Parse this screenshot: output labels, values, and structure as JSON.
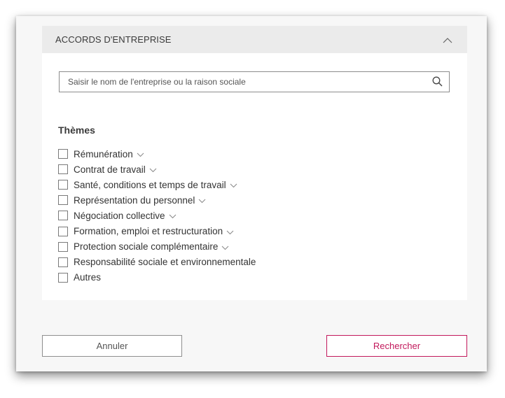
{
  "panel": {
    "title": "ACCORDS D'ENTREPRISE",
    "collapse_icon": "chevron-up-icon"
  },
  "search": {
    "placeholder": "Saisir le nom de l'entreprise ou la raison sociale",
    "value": "",
    "icon": "search-icon"
  },
  "themes": {
    "title": "Thèmes",
    "items": [
      {
        "label": "Rémunération",
        "expandable": true
      },
      {
        "label": "Contrat de travail",
        "expandable": true
      },
      {
        "label": "Santé, conditions et temps de travail",
        "expandable": true
      },
      {
        "label": "Représentation du personnel",
        "expandable": true
      },
      {
        "label": "Négociation collective",
        "expandable": true
      },
      {
        "label": "Formation, emploi et restructuration",
        "expandable": true
      },
      {
        "label": "Protection sociale complémentaire",
        "expandable": true
      },
      {
        "label": "Responsabilité sociale et environnementale",
        "expandable": false
      },
      {
        "label": "Autres",
        "expandable": false
      }
    ]
  },
  "buttons": {
    "cancel_label": "Annuler",
    "search_label": "Rechercher"
  },
  "colors": {
    "accent": "#c2185b",
    "header_bg": "#ebebeb",
    "modal_bg": "#f7f7f7"
  }
}
